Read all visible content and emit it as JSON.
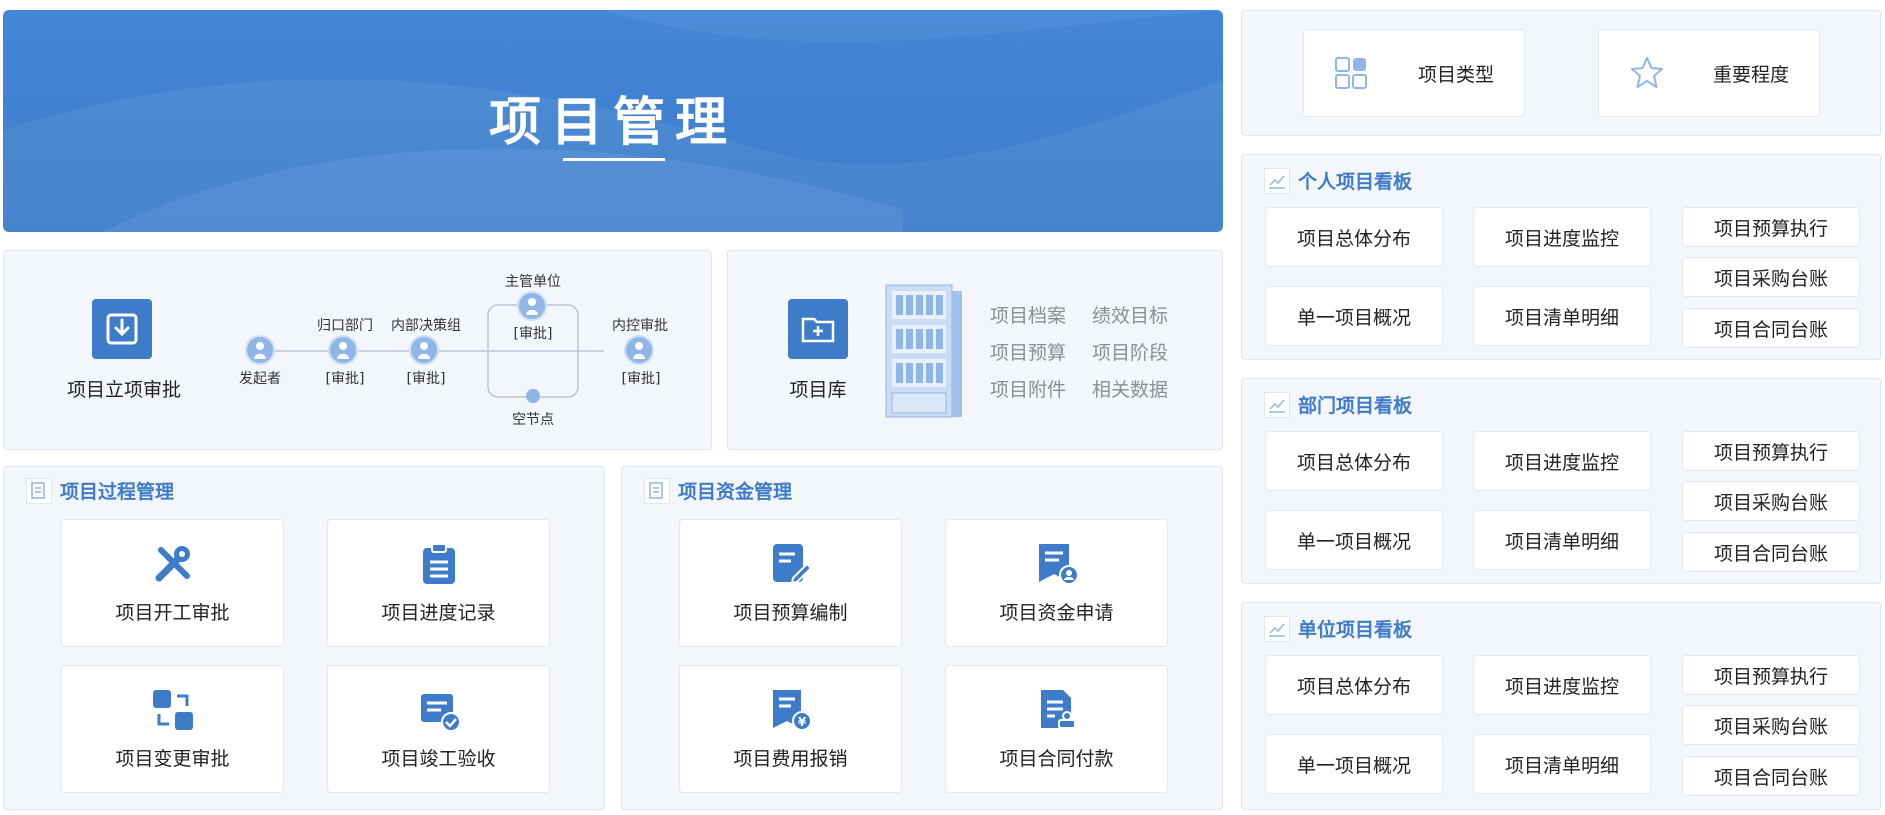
{
  "banner": {
    "title": "项目管理"
  },
  "approval": {
    "label": "项目立项审批",
    "flow": {
      "initiator": "发起者",
      "dept": "归口部门",
      "dept_tag": "[审批]",
      "committee": "内部决策组",
      "committee_tag": "[审批]",
      "supervisor": "主管单位",
      "supervisor_tag": "[审批]",
      "empty_node": "空节点",
      "control": "内控审批",
      "control_tag": "[审批]"
    }
  },
  "library": {
    "label": "项目库",
    "tags": [
      "项目档案",
      "绩效目标",
      "项目预算",
      "项目阶段",
      "项目附件",
      "相关数据"
    ]
  },
  "process": {
    "title": "项目过程管理",
    "items": [
      "项目开工审批",
      "项目进度记录",
      "项目变更审批",
      "项目竣工验收"
    ]
  },
  "funds": {
    "title": "项目资金管理",
    "items": [
      "项目预算编制",
      "项目资金申请",
      "项目费用报销",
      "项目合同付款"
    ]
  },
  "top_right": {
    "type": "项目类型",
    "importance": "重要程度"
  },
  "boards": [
    {
      "title": "个人项目看板",
      "items": [
        "项目总体分布",
        "项目进度监控",
        "项目预算执行",
        "项目采购台账",
        "单一项目概况",
        "项目清单明细",
        "项目合同台账"
      ]
    },
    {
      "title": "部门项目看板",
      "items": [
        "项目总体分布",
        "项目进度监控",
        "项目预算执行",
        "项目采购台账",
        "单一项目概况",
        "项目清单明细",
        "项目合同台账"
      ]
    },
    {
      "title": "单位项目看板",
      "items": [
        "项目总体分布",
        "项目进度监控",
        "项目预算执行",
        "项目采购台账",
        "单一项目概况",
        "项目清单明细",
        "项目合同台账"
      ]
    }
  ],
  "colors": {
    "accent": "#3e7cc9",
    "panel": "#f3f6fb",
    "banner": "#4387d6"
  }
}
